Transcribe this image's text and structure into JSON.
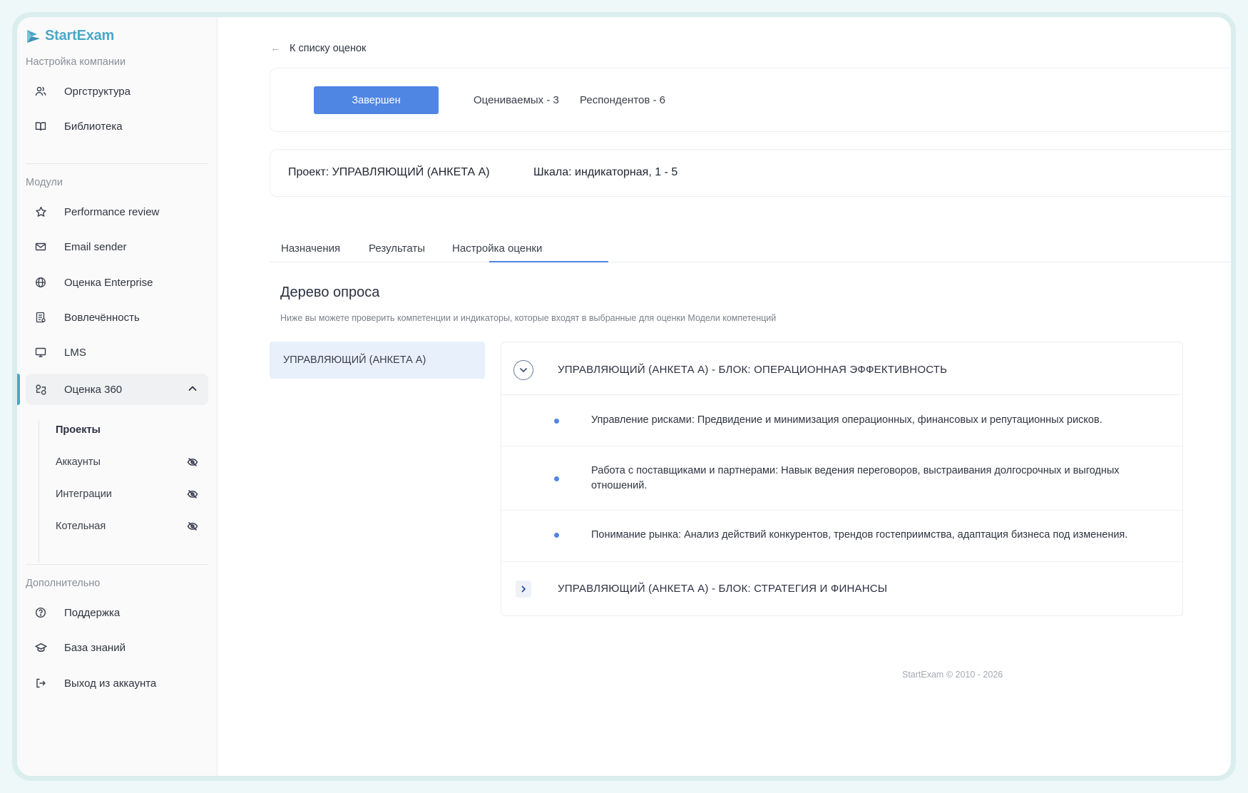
{
  "app": {
    "name": "StartExam"
  },
  "sidebar": {
    "section_company": "Настройка компании",
    "company_items": [
      {
        "label": "Оргструктура",
        "icon": "users-icon"
      },
      {
        "label": "Библиотека",
        "icon": "book-icon"
      }
    ],
    "section_modules": "Модули",
    "module_items": [
      {
        "label": "Performance review",
        "icon": "star-icon"
      },
      {
        "label": "Email sender",
        "icon": "mail-icon"
      },
      {
        "label": "Оценка Enterprise",
        "icon": "globe-icon"
      },
      {
        "label": "Вовлечённость",
        "icon": "clipboard-icon"
      },
      {
        "label": "LMS",
        "icon": "monitor-icon"
      },
      {
        "label": "Оценка 360",
        "icon": "circles-icon"
      }
    ],
    "sub_items": [
      {
        "label": "Проекты"
      },
      {
        "label": "Аккаунты",
        "icon": "eye-off-icon"
      },
      {
        "label": "Интеграции",
        "icon": "eye-off-icon"
      },
      {
        "label": "Котельная",
        "icon": "eye-off-icon"
      }
    ],
    "section_extra": "Дополнительно",
    "extra_items": [
      {
        "label": "Поддержка",
        "icon": "help-circle-icon"
      },
      {
        "label": "База знаний",
        "icon": "graduation-cap-icon"
      },
      {
        "label": "Выход из аккаунта",
        "icon": "logout-icon"
      }
    ]
  },
  "main": {
    "back_label": "К списку оценок",
    "status_button": "Завершен",
    "evaluated": "Оцениваемых - 3",
    "respondents": "Респондентов - 6",
    "project": "Проект: УПРАВЛЯЮЩИЙ (АНКЕТА А)",
    "scale": "Шкала: индикаторная, 1 - 5",
    "tabs": [
      "Назначения",
      "Результаты",
      "Настройка оценки"
    ],
    "active_tab": "Настройка оценки",
    "tree_title": "Дерево опроса",
    "tree_desc": "Ниже вы можете проверить компетенции и индикаторы, которые входят в выбранные для оценки Модели компетенций",
    "model_item": "УПРАВЛЯЮЩИЙ (АНКЕТА А)",
    "blocks": [
      {
        "title": "УПРАВЛЯЮЩИЙ (АНКЕТА А) - БЛОК: ОПЕРАЦИОННАЯ ЭФФЕКТИВНОСТЬ",
        "expanded": true,
        "indicators": [
          "Управление рисками: Предвидение и минимизация операционных, финансовых и репутационных рисков.",
          "Работа с поставщиками и партнерами: Навык ведения переговоров, выстраивания долгосрочных и выгодных отношений.",
          "Понимание рынка: Анализ действий конкурентов, трендов гостеприимства, адаптация бизнеса под изменения."
        ]
      },
      {
        "title": "УПРАВЛЯЮЩИЙ (АНКЕТА А) - БЛОК: СТРАТЕГИЯ И ФИНАНСЫ",
        "expanded": false
      }
    ],
    "footer": "StartExam © 2010 - 2026"
  },
  "colors": {
    "accent": "#4f86e4",
    "brand": "#4aa7c9",
    "selected_bg": "#e8f0fb"
  }
}
